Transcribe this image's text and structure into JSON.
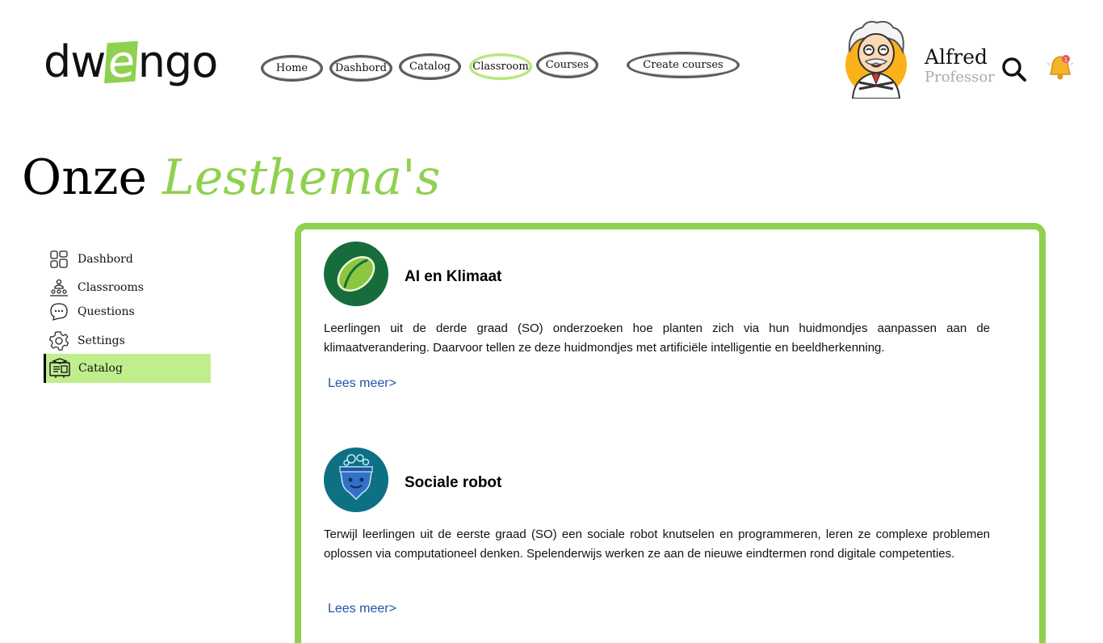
{
  "logo": {
    "part1": "dw",
    "part2": "e",
    "part3": "ngo",
    "brand_green": "#8fd14f"
  },
  "nav": {
    "home": "Home",
    "dashboard": "Dashbord",
    "catalog": "Catalog",
    "classroom": "Classroom",
    "courses": "Courses",
    "create_courses": "Create courses"
  },
  "user": {
    "name": "Alfred",
    "role": "Professor",
    "notification_count": "1"
  },
  "page": {
    "title_plain": "Onze",
    "title_accent": "Lesthema's"
  },
  "sidebar": {
    "items": [
      {
        "label": "Dashbord",
        "icon": "dashboard-icon"
      },
      {
        "label": "Classrooms",
        "icon": "classroom-icon"
      },
      {
        "label": "Questions",
        "icon": "chat-icon"
      },
      {
        "label": "Settings",
        "icon": "gear-icon"
      },
      {
        "label": "Catalog",
        "icon": "catalog-icon",
        "active": true
      }
    ]
  },
  "courses": [
    {
      "title": "AI en Klimaat",
      "description": "Leerlingen uit de derde graad (SO) onderzoeken hoe planten zich via hun huidmondjes aanpassen aan de klimaatverandering. Daarvoor tellen ze deze huidmondjes met artificiële intelligentie en beeldherkenning.",
      "read_more": "Lees meer>",
      "logo_color": "#166d3b"
    },
    {
      "title": "Sociale robot",
      "description": "Terwijl leerlingen uit de eerste graad (SO) een sociale robot knutselen en programmeren, leren ze complexe problemen oplossen via computationeel denken. Spelenderwijs werken ze aan de nieuwe eindtermen rond digitale competenties.",
      "read_more": "Lees meer>",
      "logo_color": "#0e7083"
    }
  ]
}
